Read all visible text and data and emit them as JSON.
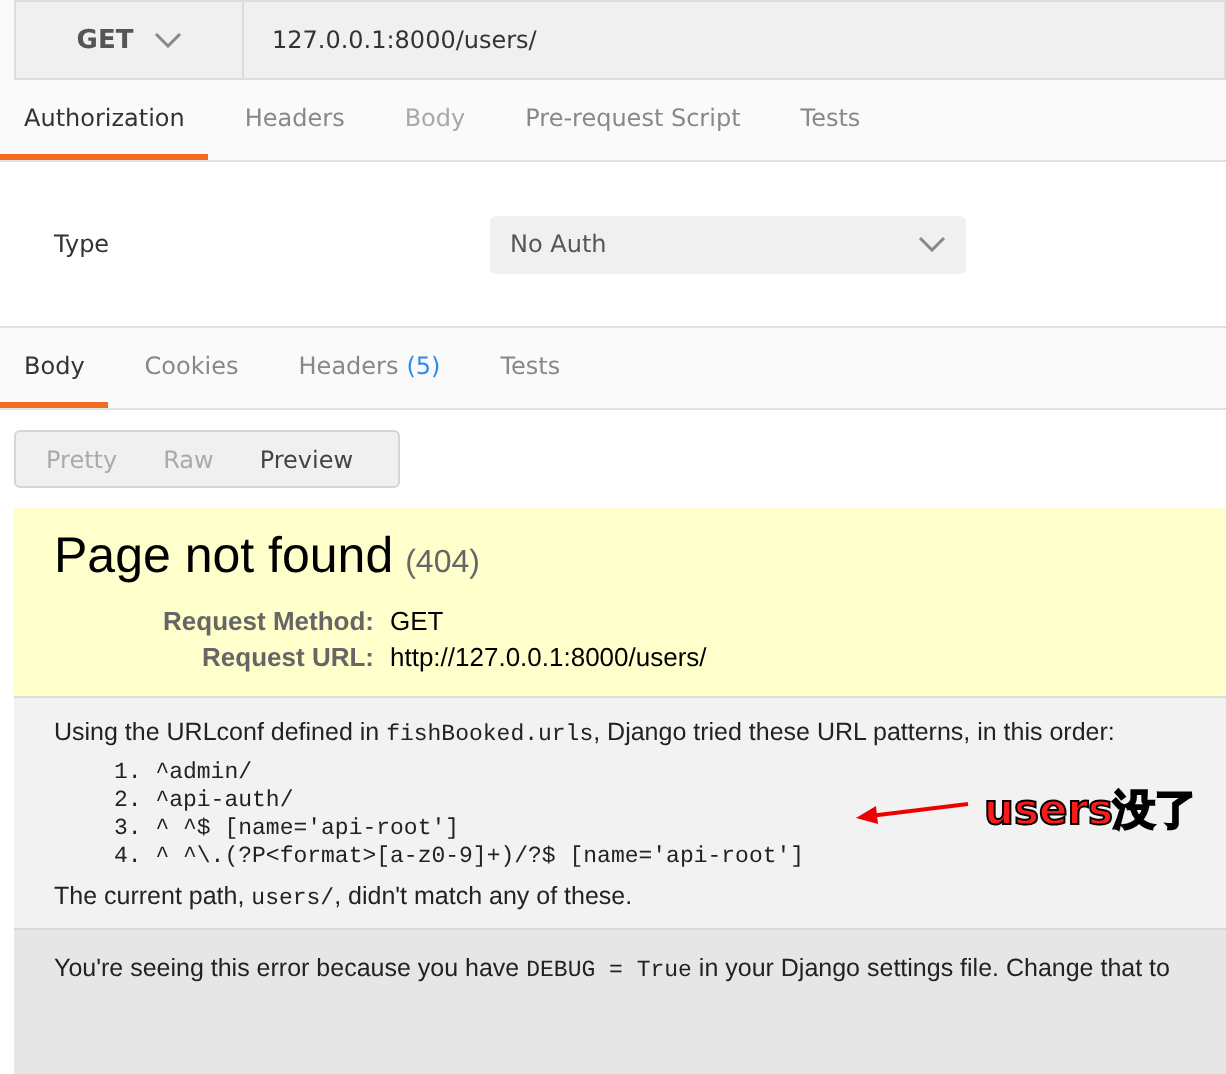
{
  "request": {
    "method": "GET",
    "url": "127.0.0.1:8000/users/"
  },
  "request_tabs": [
    {
      "label": "Authorization",
      "selected": true,
      "disabled": false
    },
    {
      "label": "Headers",
      "selected": false,
      "disabled": false
    },
    {
      "label": "Body",
      "selected": false,
      "disabled": true
    },
    {
      "label": "Pre-request Script",
      "selected": false,
      "disabled": false
    },
    {
      "label": "Tests",
      "selected": false,
      "disabled": false
    }
  ],
  "auth": {
    "label": "Type",
    "value": "No Auth"
  },
  "response_tabs": [
    {
      "label": "Body",
      "selected": true
    },
    {
      "label": "Cookies",
      "selected": false
    },
    {
      "label": "Headers",
      "count": "(5)",
      "selected": false
    },
    {
      "label": "Tests",
      "selected": false
    }
  ],
  "view_modes": [
    {
      "label": "Pretty",
      "selected": false
    },
    {
      "label": "Raw",
      "selected": false
    },
    {
      "label": "Preview",
      "selected": true
    }
  ],
  "error_page": {
    "title": "Page not found",
    "code": "(404)",
    "fields": [
      {
        "label": "Request Method:",
        "value": "GET"
      },
      {
        "label": "Request URL:",
        "value": "http://127.0.0.1:8000/users/"
      }
    ],
    "intro": [
      {
        "kind": "text",
        "text": "Using the URLconf defined in "
      },
      {
        "kind": "code",
        "text": "fishBooked.urls"
      },
      {
        "kind": "text",
        "text": ", Django tried these URL patterns, in this order:"
      }
    ],
    "patterns": [
      {
        "number": "1.",
        "pattern": "^admin/"
      },
      {
        "number": "2.",
        "pattern": "^api-auth/"
      },
      {
        "number": "3.",
        "pattern": "^ ^$ [name='api-root']"
      },
      {
        "number": "4.",
        "pattern": "^ ^\\.(?P<format>[a-z0-9]+)/?$ [name='api-root']"
      }
    ],
    "current_path": [
      {
        "kind": "text",
        "text": "The current path, "
      },
      {
        "kind": "code",
        "text": "users/"
      },
      {
        "kind": "text",
        "text": ", didn't match any of these."
      }
    ],
    "debug_note": [
      {
        "kind": "text",
        "text": "You're seeing this error because you have "
      },
      {
        "kind": "code",
        "text": "DEBUG = True"
      },
      {
        "kind": "text",
        "text": " in your Django settings file. Change that to"
      }
    ]
  },
  "annotation": {
    "text": "users没了"
  }
}
